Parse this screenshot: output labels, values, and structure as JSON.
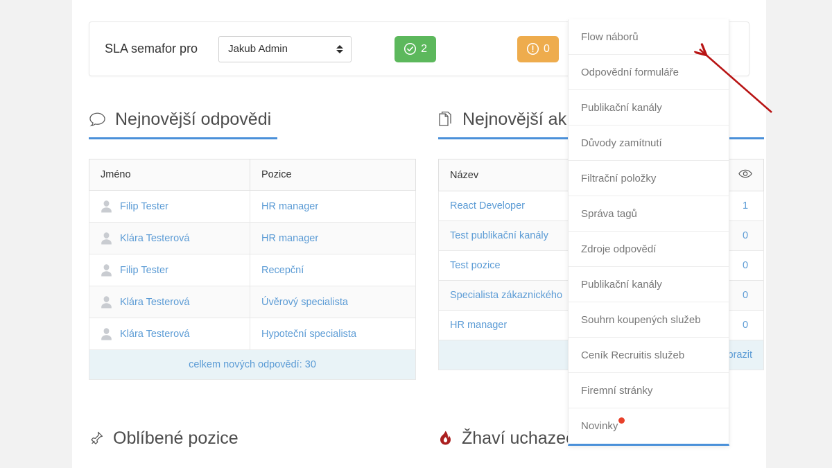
{
  "sla_bar": {
    "label": "SLA semafor pro",
    "select": {
      "value": "Jakub Admin",
      "icon": "updown-caret-icon"
    },
    "badges": [
      {
        "icon": "check-circle-icon",
        "count": "2",
        "color": "#5cb85c"
      },
      {
        "icon": "exclamation-circle-icon",
        "count": "0",
        "color": "#eeac4d"
      }
    ]
  },
  "left_panel": {
    "icon": "speech-bubble-icon",
    "title": "Nejnovější odpovědi",
    "columns": [
      "Jméno",
      "Pozice"
    ],
    "rows": [
      {
        "name": "Filip Tester",
        "position": "HR manager"
      },
      {
        "name": "Klára Testerová",
        "position": "HR manager"
      },
      {
        "name": "Filip Tester",
        "position": "Recepční"
      },
      {
        "name": "Klára Testerová",
        "position": "Úvěrový specialista"
      },
      {
        "name": "Klára Testerová",
        "position": "Hypoteční specialista"
      }
    ],
    "footer": "celkem nových odpovědí: 30"
  },
  "right_panel": {
    "icon": "documents-icon",
    "title": "Nejnovější ak",
    "columns": [
      "Název",
      "views-eye-icon"
    ],
    "rows": [
      {
        "name": "React Developer",
        "views": "1"
      },
      {
        "name": "Test publikační kanály",
        "views": "0"
      },
      {
        "name": "Test pozice",
        "views": "0"
      },
      {
        "name": "Specialista zákaznického",
        "views": "0"
      },
      {
        "name": "HR manager",
        "views": "0"
      }
    ],
    "footer": "Zobrazit"
  },
  "bottom_sections": [
    {
      "icon": "pin-icon",
      "title": "Oblíbené pozice"
    },
    {
      "icon": "flame-icon",
      "title": "Žhaví uchazeči"
    }
  ],
  "dropdown": {
    "items": [
      {
        "label": "Flow náborů",
        "dot": false
      },
      {
        "label": "Odpovědní formuláře",
        "dot": false
      },
      {
        "label": "Publikační kanály",
        "dot": false
      },
      {
        "label": "Důvody zamítnutí",
        "dot": false
      },
      {
        "label": "Filtrační položky",
        "dot": false
      },
      {
        "label": "Správa tagů",
        "dot": false
      },
      {
        "label": "Zdroje odpovědí",
        "dot": false
      },
      {
        "label": "Publikační kanály",
        "dot": false
      },
      {
        "label": "Souhrn koupených služeb",
        "dot": false
      },
      {
        "label": "Ceník Recruitis služeb",
        "dot": false
      },
      {
        "label": "Firemní stránky",
        "dot": false
      },
      {
        "label": "Novinky",
        "dot": true
      }
    ],
    "accent_color": "#4a90d9"
  },
  "annotation": {
    "arrow_color": "#b81414",
    "points_to": "Flow náborů"
  }
}
